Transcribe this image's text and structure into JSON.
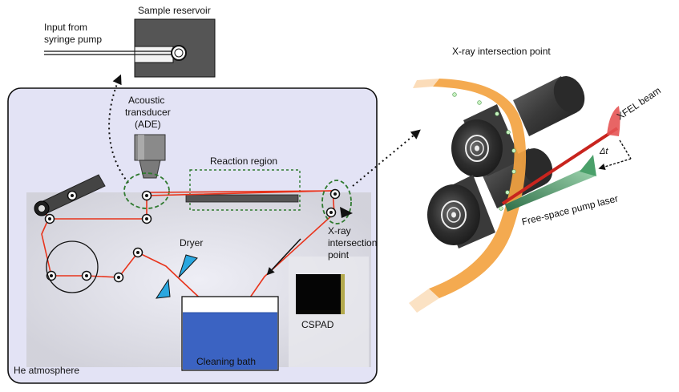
{
  "labels": {
    "input_line1": "Input from",
    "input_line2": "syringe pump",
    "sample_reservoir": "Sample reservoir",
    "acoustic_line1": "Acoustic",
    "acoustic_line2": "transducer",
    "acoustic_line3": "(ADE)",
    "reaction_region": "Reaction region",
    "xray_line1": "X-ray",
    "xray_line2": "intersection",
    "xray_line3": "point",
    "dryer": "Dryer",
    "cspad": "CSPAD",
    "cleaning_bath": "Cleaning bath",
    "he_atmosphere": "He atmosphere",
    "xray_intersection_title": "X-ray intersection point",
    "xfel_beam": "XFEL beam",
    "delta_t": "Δt",
    "pump_laser": "Free-space pump laser"
  },
  "colors": {
    "chamber_fill": "#e3e3f5",
    "chamber_inner": "#d6d6dc",
    "tape": "#e8341c",
    "bath_water": "#3b63c2",
    "dryer": "#2aa7e0",
    "orange_tape": "#f3a341",
    "roller_dark": "#2b2b2b",
    "xfel_red": "#c8241e",
    "pump_green": "#3c8a57",
    "dashed_green": "#2f7a2f"
  }
}
